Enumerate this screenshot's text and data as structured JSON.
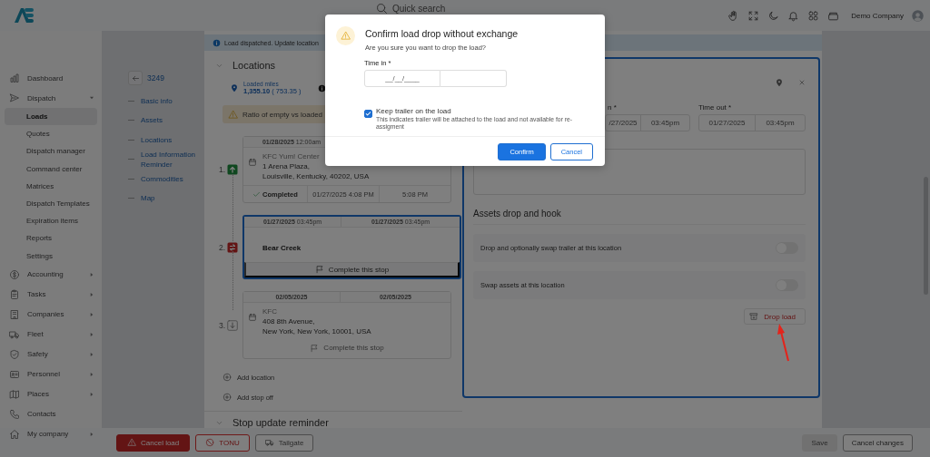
{
  "header": {
    "search_placeholder": "Quick search",
    "company": "Demo Company"
  },
  "sidebar": {
    "items": [
      {
        "label": "Dashboard",
        "selected": false
      },
      {
        "label": "Dispatch",
        "selected": false,
        "expanded": true,
        "children": [
          {
            "label": "Loads",
            "selected": true
          },
          {
            "label": "Quotes",
            "selected": false
          },
          {
            "label": "Dispatch manager",
            "selected": false
          },
          {
            "label": "Command center",
            "selected": false
          },
          {
            "label": "Matrices",
            "selected": false
          },
          {
            "label": "Dispatch Templates",
            "selected": false
          },
          {
            "label": "Expiration items",
            "selected": false
          },
          {
            "label": "Reports",
            "selected": false
          },
          {
            "label": "Settings",
            "selected": false
          }
        ]
      },
      {
        "label": "Accounting",
        "selected": false,
        "expanded": false
      },
      {
        "label": "Tasks",
        "selected": false,
        "expanded": false
      },
      {
        "label": "Companies",
        "selected": false,
        "expanded": false
      },
      {
        "label": "Fleet",
        "selected": false,
        "expanded": false
      },
      {
        "label": "Safety",
        "selected": false,
        "expanded": false
      },
      {
        "label": "Personnel",
        "selected": false,
        "expanded": false
      },
      {
        "label": "Places",
        "selected": false,
        "expanded": false
      },
      {
        "label": "Contacts",
        "selected": false
      },
      {
        "label": "My company",
        "selected": false,
        "expanded": false
      }
    ]
  },
  "load_nav": {
    "load_number": "3249",
    "links": [
      "Basic info",
      "Assets",
      "Locations",
      "Load Information Reminder",
      "Commodities",
      "Map"
    ]
  },
  "banner": {
    "text": "Load dispatched. Update location"
  },
  "locations": {
    "title": "Locations",
    "loaded_miles_label": "Loaded miles",
    "loaded_miles": "1,355.10",
    "empty_miles": "( 753.35 )",
    "ratio_warning": "Ratio of empty vs loaded",
    "stops": [
      {
        "number": "1.",
        "kind": "pickup",
        "active": false,
        "date_in": "01/28/2025",
        "time_in": "12:00am",
        "name": "KFC Yum! Center",
        "address": [
          "1 Arena Plaza,",
          "Louisville, Kentucky, 40202, USA"
        ],
        "status": "Completed",
        "completed_in": "01/27/2025 4:08 PM",
        "completed_out": "5:08 PM"
      },
      {
        "number": "2.",
        "kind": "swap",
        "active": true,
        "date_in": "01/27/2025",
        "time_in": "03:45pm",
        "date_out": "01/27/2025",
        "time_out": "03:45pm",
        "name": "Bear Creek",
        "action": "Complete this stop"
      },
      {
        "number": "3.",
        "kind": "dropoff",
        "active": false,
        "date_in": "02/05/2025",
        "date_out": "02/05/2025",
        "name": "KFC",
        "address": [
          "408 8th Avenue,",
          "New York, New York, 10001, USA"
        ],
        "action": "Complete this stop"
      }
    ],
    "add_links": [
      "Add location",
      "Add stop off"
    ]
  },
  "next_section": {
    "title": "Stop update reminder"
  },
  "stop_editor": {
    "time_in_label": "n *",
    "time_in_date": "/27/2025",
    "time_in_time": "03:45pm",
    "time_out_label": "Time out *",
    "time_out_date": "01/27/2025",
    "time_out_time": "03:45pm",
    "assets_title": "Assets drop and hook",
    "toggles": [
      {
        "label": "Drop and optionally swap trailer at this location",
        "on": false
      },
      {
        "label": "Swap assets at this location",
        "on": false
      }
    ],
    "drop_button": "Drop load"
  },
  "actions": {
    "left": [
      {
        "label": "Cancel load",
        "kind": "danger"
      },
      {
        "label": "TONU",
        "kind": "outline"
      },
      {
        "label": "Tailgate",
        "kind": "neutral"
      }
    ],
    "right": [
      {
        "label": "Save",
        "disabled": true
      },
      {
        "label": "Cancel changes",
        "disabled": false
      }
    ]
  },
  "dialog": {
    "title": "Confirm load drop without exchange",
    "message": "Are you sure you want to drop the load?",
    "time_in_label": "Time in *",
    "date_placeholder": "__/__/____",
    "keep_trailer": {
      "label": "Keep trailer on the load",
      "description": "This indicates trailer will be attached to the load and not available for re-assigment",
      "checked": true
    },
    "buttons": [
      {
        "label": "Confirm",
        "kind": "primary"
      },
      {
        "label": "Cancel",
        "kind": "secondary"
      }
    ]
  }
}
